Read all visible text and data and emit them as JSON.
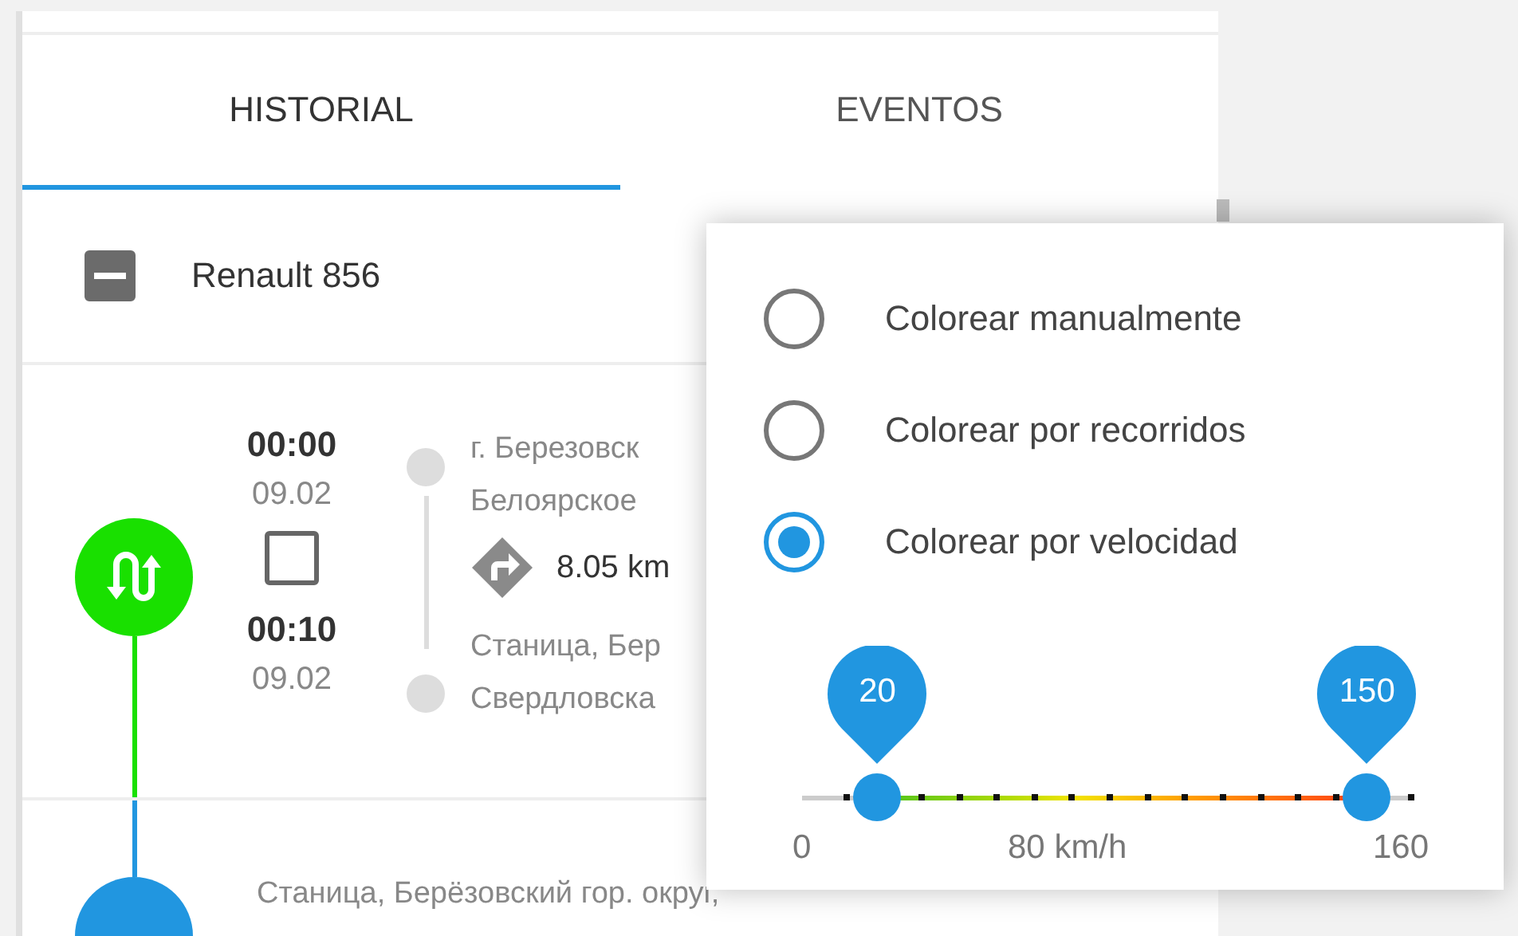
{
  "tabs": [
    {
      "label": "HISTORIAL",
      "selected": true
    },
    {
      "label": "EVENTOS",
      "selected": false
    }
  ],
  "vehicle": {
    "name": "Renault 856",
    "indeterminate": true
  },
  "trip": {
    "start_time": "00:00",
    "start_date": "09.02",
    "checked": false,
    "end_time": "00:10",
    "end_date": "09.02",
    "start_address": [
      "г. Березовск",
      "Белоярское"
    ],
    "distance": "8.05 km",
    "end_address": [
      "Станица, Бер",
      "Свердловска"
    ]
  },
  "next_stop": {
    "address": "Станица, Берёзовский гор. округ,"
  },
  "popup": {
    "options": [
      {
        "label": "Colorear manualmente",
        "selected": false
      },
      {
        "label": "Colorear por recorridos",
        "selected": false
      },
      {
        "label": "Colorear por velocidad",
        "selected": true
      }
    ],
    "slider": {
      "low": {
        "label": "20",
        "level": 0.125
      },
      "high": {
        "label": "150",
        "level": 0.9375
      },
      "min_label": "0",
      "mid_label": "80 km/h",
      "max_label": "160"
    }
  }
}
